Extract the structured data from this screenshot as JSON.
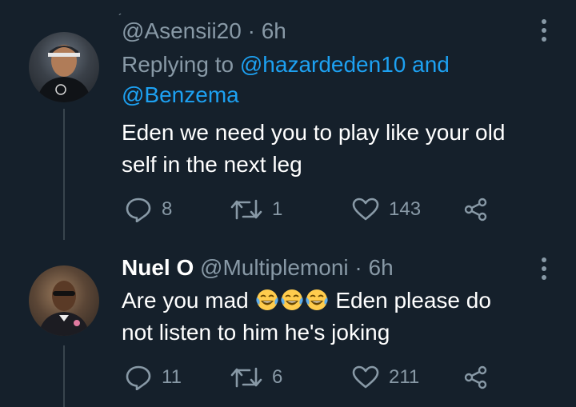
{
  "tweets": [
    {
      "handle": "@Asensii20",
      "separator": "·",
      "time": "6h",
      "replying_prefix": "Replying to",
      "replying_user1": "@hazardeden10",
      "replying_and": "and",
      "replying_user2": "@Benzema",
      "text_line1": "Eden we need you to play like your old",
      "text_line2": "self in the next leg",
      "replies": "8",
      "retweets": "1",
      "likes": "143"
    },
    {
      "name": "Nuel O",
      "handle": "@Multiplemoni",
      "separator": "·",
      "time": "6h",
      "text_line1_start": "Are you mad",
      "text_line1_end": "Eden please do",
      "text_line2": "not listen to him he's joking",
      "replies": "11",
      "retweets": "6",
      "likes": "211"
    }
  ],
  "icons": {
    "reply": "reply-icon",
    "retweet": "retweet-icon",
    "like": "heart-icon",
    "share": "share-icon",
    "more": "more-icon",
    "emoji": "face-with-tears-of-joy-emoji"
  },
  "colors": {
    "background": "#15202b",
    "muted": "#8899a6",
    "link": "#1da1f2",
    "thread": "#38444d"
  }
}
